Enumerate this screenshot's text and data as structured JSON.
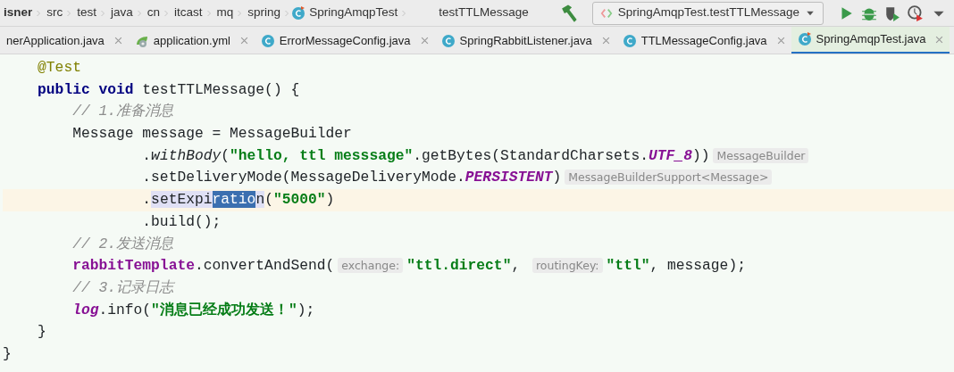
{
  "breadcrumbs": [
    "isner",
    "src",
    "test",
    "java",
    "cn",
    "itcast",
    "mq",
    "spring",
    "SpringAmqpTest",
    "testTTLMessage"
  ],
  "toolbar": {
    "run_config": "SpringAmqpTest.testTTLMessage"
  },
  "tabs": [
    {
      "label": "nerApplication.java",
      "kind": "java",
      "selected": false
    },
    {
      "label": "application.yml",
      "kind": "yml",
      "selected": false
    },
    {
      "label": "ErrorMessageConfig.java",
      "kind": "class",
      "selected": false
    },
    {
      "label": "SpringRabbitListener.java",
      "kind": "class",
      "selected": false
    },
    {
      "label": "TTLMessageConfig.java",
      "kind": "class",
      "selected": false
    },
    {
      "label": "SpringAmqpTest.java",
      "kind": "test",
      "selected": true
    }
  ],
  "code": [
    {
      "current": false,
      "tokens": [
        {
          "kind": "annotation",
          "text": "    @Test"
        }
      ]
    },
    {
      "current": false,
      "tokens": [
        {
          "kind": "keyword",
          "text": "    public void "
        },
        {
          "kind": "plain",
          "text": "testTTLMessage() {"
        }
      ]
    },
    {
      "current": false,
      "tokens": [
        {
          "kind": "comment",
          "text": "        // 1.准备消息"
        }
      ]
    },
    {
      "current": false,
      "tokens": [
        {
          "kind": "plain",
          "text": "        Message message = MessageBuilder"
        }
      ]
    },
    {
      "current": false,
      "tokens": [
        {
          "kind": "plain",
          "text": "                ."
        },
        {
          "kind": "static",
          "text": "withBody"
        },
        {
          "kind": "plain",
          "text": "("
        },
        {
          "kind": "string",
          "text": "\"hello, ttl messsage\""
        },
        {
          "kind": "plain",
          "text": ".getBytes(StandardCharsets."
        },
        {
          "kind": "constant",
          "text": "UTF_8"
        },
        {
          "kind": "plain",
          "text": "))"
        },
        {
          "kind": "hint",
          "text": "MessageBuilder"
        }
      ]
    },
    {
      "current": false,
      "tokens": [
        {
          "kind": "plain",
          "text": "                .setDeliveryMode(MessageDeliveryMode."
        },
        {
          "kind": "constant",
          "text": "PERSISTENT"
        },
        {
          "kind": "plain",
          "text": ")"
        },
        {
          "kind": "hint",
          "text": "MessageBuilderSupport<Message>"
        }
      ]
    },
    {
      "current": true,
      "tokens": [
        {
          "kind": "plain",
          "text": "                ."
        },
        {
          "kind": "usage",
          "text": "setExpi"
        },
        {
          "kind": "selection",
          "text": "ratio"
        },
        {
          "kind": "usage",
          "text": "n"
        },
        {
          "kind": "plain",
          "text": "("
        },
        {
          "kind": "string",
          "text": "\"5000\""
        },
        {
          "kind": "plain",
          "text": ")"
        }
      ]
    },
    {
      "current": false,
      "tokens": [
        {
          "kind": "plain",
          "text": "                .build();"
        }
      ]
    },
    {
      "current": false,
      "tokens": [
        {
          "kind": "comment",
          "text": "        // 2.发送消息"
        }
      ]
    },
    {
      "current": false,
      "tokens": [
        {
          "kind": "field",
          "text": "        rabbitTemplate"
        },
        {
          "kind": "plain",
          "text": ".convertAndSend("
        },
        {
          "kind": "hint",
          "text": "exchange:"
        },
        {
          "kind": "string",
          "text": "\"ttl.direct\""
        },
        {
          "kind": "plain",
          "text": ", "
        },
        {
          "kind": "hint",
          "text": "routingKey:"
        },
        {
          "kind": "string",
          "text": "\"ttl\""
        },
        {
          "kind": "plain",
          "text": ", message);"
        }
      ]
    },
    {
      "current": false,
      "tokens": [
        {
          "kind": "comment",
          "text": "        // 3.记录日志"
        }
      ]
    },
    {
      "current": false,
      "tokens": [
        {
          "kind": "staticfield",
          "text": "        log"
        },
        {
          "kind": "plain",
          "text": ".info("
        },
        {
          "kind": "string",
          "text": "\"消息已经成功发送！\""
        },
        {
          "kind": "plain",
          "text": ");"
        }
      ]
    },
    {
      "current": false,
      "tokens": [
        {
          "kind": "plain",
          "text": "    }"
        }
      ]
    },
    {
      "current": false,
      "tokens": [
        {
          "kind": "plain",
          "text": "}"
        }
      ]
    }
  ]
}
